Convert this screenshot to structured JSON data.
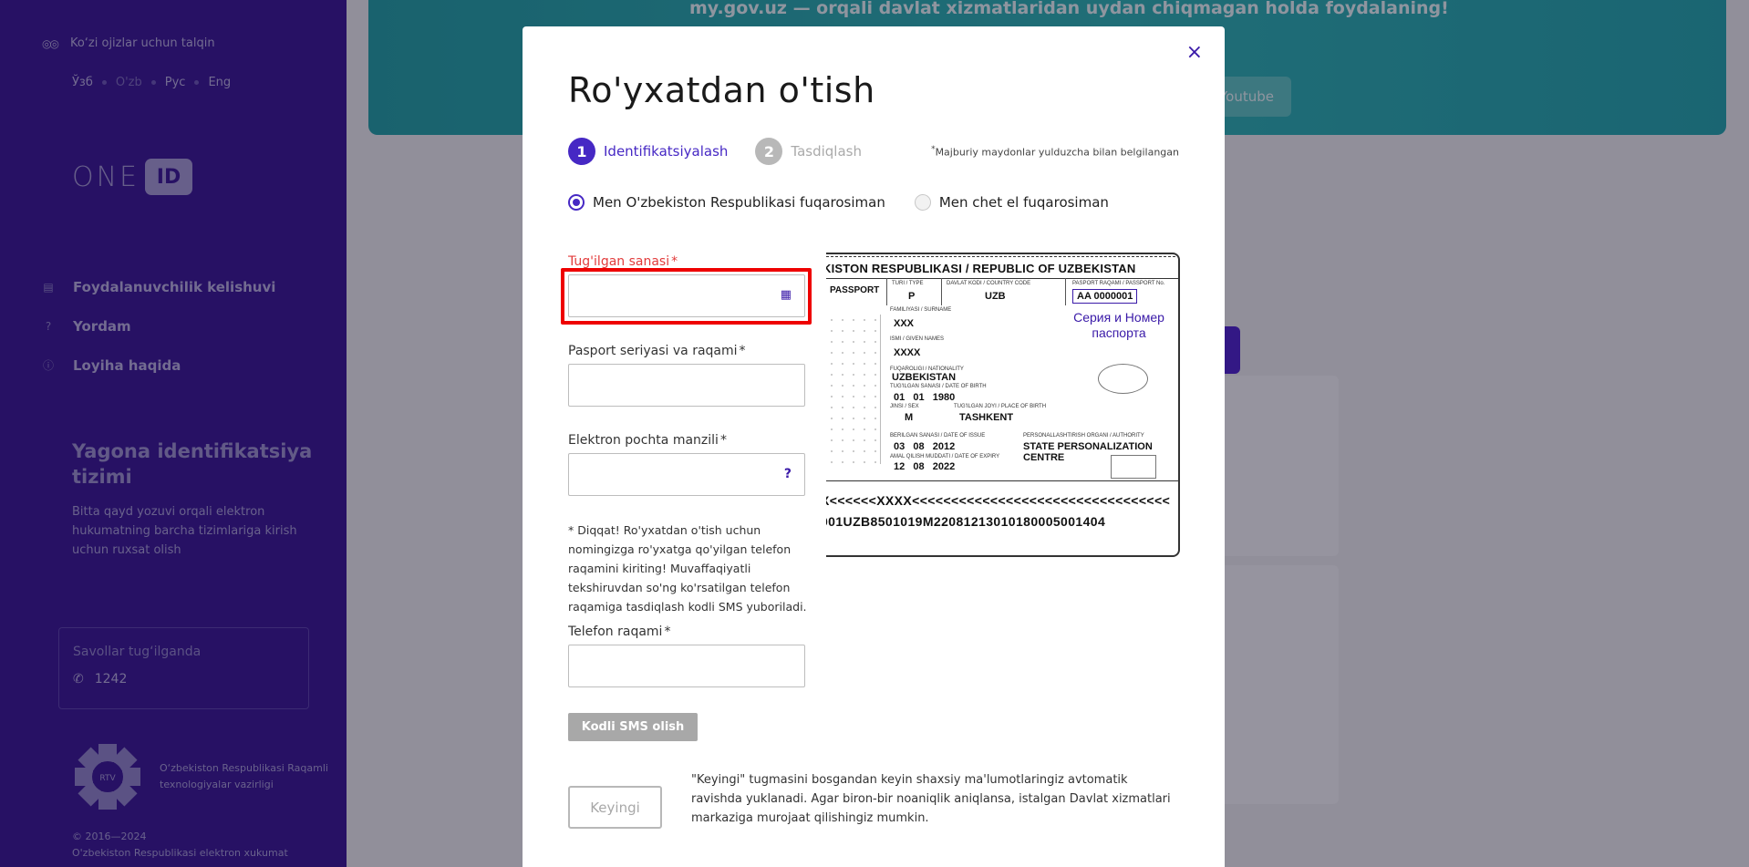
{
  "sidebar": {
    "accessibility_label": "Ko‘zi ojizlar uchun talqin",
    "languages": [
      "Ўзб",
      "O'zb",
      "Рус",
      "Eng"
    ],
    "logo_one": "ONE",
    "logo_id": "ID",
    "nav": [
      {
        "icon": "document-icon",
        "label": "Foydalanuvchilik kelishuvi"
      },
      {
        "icon": "question-icon",
        "label": "Yordam"
      },
      {
        "icon": "info-icon",
        "label": "Loyiha haqida"
      }
    ],
    "promo_title": "Yagona identifikatsiya tizimi",
    "promo_text": "Bitta qayd yozuvi orqali elektron hukumatning barcha tizimlariga kirish uchun ruxsat olish",
    "support_question": "Savollar tug‘ilganda",
    "support_phone": "1242",
    "ministry_text": "O‘zbekiston Respublikasi Raqamli texnologiyalar vazirligi",
    "emblem_text": "RTV",
    "copyright_years": "© 2016—2024",
    "copyright_text": "O'zbekiston Respublikasi elektron xukumat"
  },
  "background": {
    "banner_text": "my.gov.uz  — orqali davlat xizmatlaridan uydan chiqmagan holda foydalaning!",
    "youtube_label": "Youtube"
  },
  "modal": {
    "title": "Ro'yxatdan o'tish",
    "steps": [
      {
        "num": "1",
        "label": "Identifikatsiyalash",
        "active": true
      },
      {
        "num": "2",
        "label": "Tasdiqlash",
        "active": false
      }
    ],
    "required_note_star": "*",
    "required_note": "Majburiy maydonlar yulduzcha bilan belgilangan",
    "radio_uz": "Men O'zbekiston Respublikasi fuqarosiman",
    "radio_foreign": "Men chet el fuqarosiman",
    "fields": {
      "birthdate": {
        "label": "Tug'ilgan sanasi",
        "value": ""
      },
      "passport": {
        "label": "Pasport seriyasi va raqami",
        "value": ""
      },
      "email": {
        "label": "Elektron pochta manzili",
        "value": "",
        "help": "?"
      },
      "phone": {
        "label": "Telefon raqami",
        "value": ""
      }
    },
    "required_star": "*",
    "warning": "* Diqqat! Ro'yxatdan o'tish uchun nomingizga ro'yxatga qo'yilgan telefon raqamini kiriting! Muvaffaqiyatli tekshiruvdan so'ng ko'rsatilgan telefon raqamiga tasdiqlash kodli SMS yuboriladi.",
    "sms_button": "Kodli SMS olish",
    "next_button": "Keyingi",
    "next_note": "\"Keyingi\" tugmasini bosgandan keyin shaxsiy ma'lumotlaringiz avtomatik ravishda yuklanadi. Agar biron-bir noaniqlik aniqlansa, istalgan Davlat xizmatlari markaziga murojaat qilishingiz mumkin.",
    "close": "×"
  },
  "passport": {
    "header": "KISTON RESPUBLIKASI / REPUBLIC OF UZBEKISTAN",
    "passport_label": "PASSPORT",
    "type_label": "TURI / TYPE",
    "type_value": "P",
    "country_label": "DAVLAT KODI / COUNTRY CODE",
    "country_value": "UZB",
    "number_label": "PASPORT RAQAMI / PASSPORT No.",
    "number_value": "AA 0000001",
    "series_caption_1": "Серия и Номер",
    "series_caption_2": "паспорта",
    "surname_label": "FAMILIYASI / SURNAME",
    "surname_value": "XXX",
    "name_label": "ISMI / GIVEN NAMES",
    "name_value": "XXXX",
    "nationality_label": "FUQAROLIGI / NATIONALITY",
    "nationality_value": "UZBEKISTAN",
    "dob_label": "TUG'ILGAN SANASI / DATE OF BIRTH",
    "dob_value": "01   01   1980",
    "sex_label": "JINSI / SEX",
    "sex_value": "M",
    "pob_label": "TUG'ILGAN JOYI / PLACE OF BIRTH",
    "pob_value": "TASHKENT",
    "issue_label": "BERILGAN SANASI / DATE OF ISSUE",
    "issue_value": "03   08   2012",
    "authority_label": "PERSONALLASHTIRISH ORGANI / AUTHORITY",
    "authority_value_1": "STATE PERSONALIZATION",
    "authority_value_2": "CENTRE",
    "expiry_label": "AMAL QILISH MUDDATI / DATE OF EXPIRY",
    "expiry_value": "12   08   2022",
    "mrz_1": "X<<<<<<XXXX<<<<<<<<<<<<<<<<<<<<<<<<<<<<<<<<<",
    "mrz_2": "001UZB8501019M2208121301018000500140​4"
  }
}
